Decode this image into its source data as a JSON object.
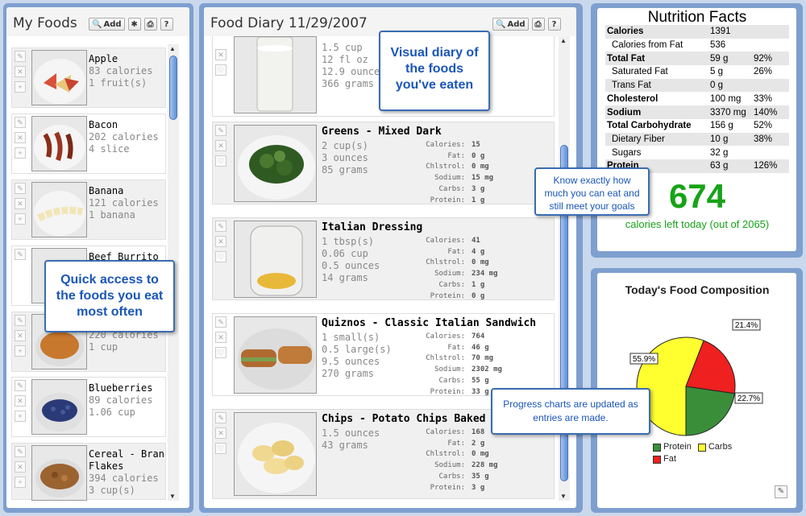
{
  "my_foods": {
    "title": "My Foods",
    "add_label": "Add",
    "items": [
      {
        "name": "Apple",
        "calories": "83 calories",
        "serving": "1 fruit(s)"
      },
      {
        "name": "Bacon",
        "calories": "202 calories",
        "serving": "4 slice"
      },
      {
        "name": "Banana",
        "calories": "121 calories",
        "serving": "1 banana"
      },
      {
        "name": "Beef Burrito",
        "calories": "",
        "serving": ""
      },
      {
        "name": "",
        "calories": "220 calories",
        "serving": "1 cup"
      },
      {
        "name": "Blueberries",
        "calories": "89 calories",
        "serving": "1.06 cup"
      },
      {
        "name": "Cereal - Bran",
        "name2": "Flakes",
        "calories": "394 calories",
        "serving": "3 cup(s)"
      }
    ]
  },
  "diary": {
    "title": "Food Diary 11/29/2007",
    "add_label": "Add",
    "top_entry": {
      "quantities": [
        "1.5 cup",
        "12 fl oz",
        "12.9 ounces",
        "366 grams"
      ]
    },
    "nutrient_labels": [
      "Calories:",
      "Fat:",
      "Chlstrol:",
      "Sodium:",
      "Carbs:",
      "Protein:"
    ],
    "entries": [
      {
        "name": "Greens - Mixed Dark",
        "quantities": [
          "2 cup(s)",
          "3 ounces",
          "85 grams"
        ],
        "values": [
          "15",
          "0 g",
          "0 mg",
          "15 mg",
          "3 g",
          "1 g"
        ]
      },
      {
        "name": "Italian Dressing",
        "quantities": [
          "1 tbsp(s)",
          "0.06 cup",
          "0.5 ounces",
          "14 grams"
        ],
        "values": [
          "41",
          "4 g",
          "0 mg",
          "234 mg",
          "1 g",
          "0 g"
        ]
      },
      {
        "name": "Quiznos - Classic Italian Sandwich",
        "quantities": [
          "1 small(s)",
          "0.5 large(s)",
          "9.5 ounces",
          "270 grams"
        ],
        "values": [
          "764",
          "46 g",
          "70 mg",
          "2302 mg",
          "55 g",
          "33 g"
        ]
      },
      {
        "name": "Chips - Potato Chips Baked",
        "quantities": [
          "1.5 ounces",
          "43 grams"
        ],
        "values": [
          "168",
          "2 g",
          "0 mg",
          "228 mg",
          "35 g",
          "3 g"
        ]
      }
    ]
  },
  "nutrition": {
    "title": "Nutrition Facts",
    "rows": [
      {
        "label": "Calories",
        "amount": "1391",
        "pct": "",
        "bold": true
      },
      {
        "label": "Calories from Fat",
        "amount": "536",
        "pct": "",
        "bold": false
      },
      {
        "label": "Total Fat",
        "amount": "59 g",
        "pct": "92%",
        "bold": true
      },
      {
        "label": "Saturated Fat",
        "amount": "5 g",
        "pct": "26%",
        "bold": false
      },
      {
        "label": "Trans Fat",
        "amount": "0 g",
        "pct": "",
        "bold": false
      },
      {
        "label": "Cholesterol",
        "amount": "100 mg",
        "pct": "33%",
        "bold": true
      },
      {
        "label": "Sodium",
        "amount": "3370 mg",
        "pct": "140%",
        "bold": true
      },
      {
        "label": "Total Carbohydrate",
        "amount": "156 g",
        "pct": "52%",
        "bold": true
      },
      {
        "label": "Dietary Fiber",
        "amount": "10 g",
        "pct": "38%",
        "bold": false
      },
      {
        "label": "Sugars",
        "amount": "32 g",
        "pct": "",
        "bold": false
      },
      {
        "label": "Protein",
        "amount": "63 g",
        "pct": "126%",
        "bold": true
      }
    ],
    "calories_left": "674",
    "calories_left_label": "calories left today (out of 2065)"
  },
  "chart_data": {
    "type": "pie",
    "title": "Today's Food Composition",
    "categories": [
      "Protein",
      "Carbs",
      "Fat"
    ],
    "values": [
      22.7,
      55.9,
      21.4
    ],
    "labels": [
      "22.7%",
      "55.9%",
      "21.4%"
    ],
    "colors": [
      "#3a8e3a",
      "#ffff30",
      "#ee2020"
    ],
    "legend_position": "bottom"
  },
  "callouts": {
    "quick": "Quick access to the foods you eat most often",
    "visual": "Visual diary of the foods you've eaten",
    "know": "Know exactly how much you can eat and still meet your goals",
    "progress": "Progress charts are updated as entries are made."
  }
}
